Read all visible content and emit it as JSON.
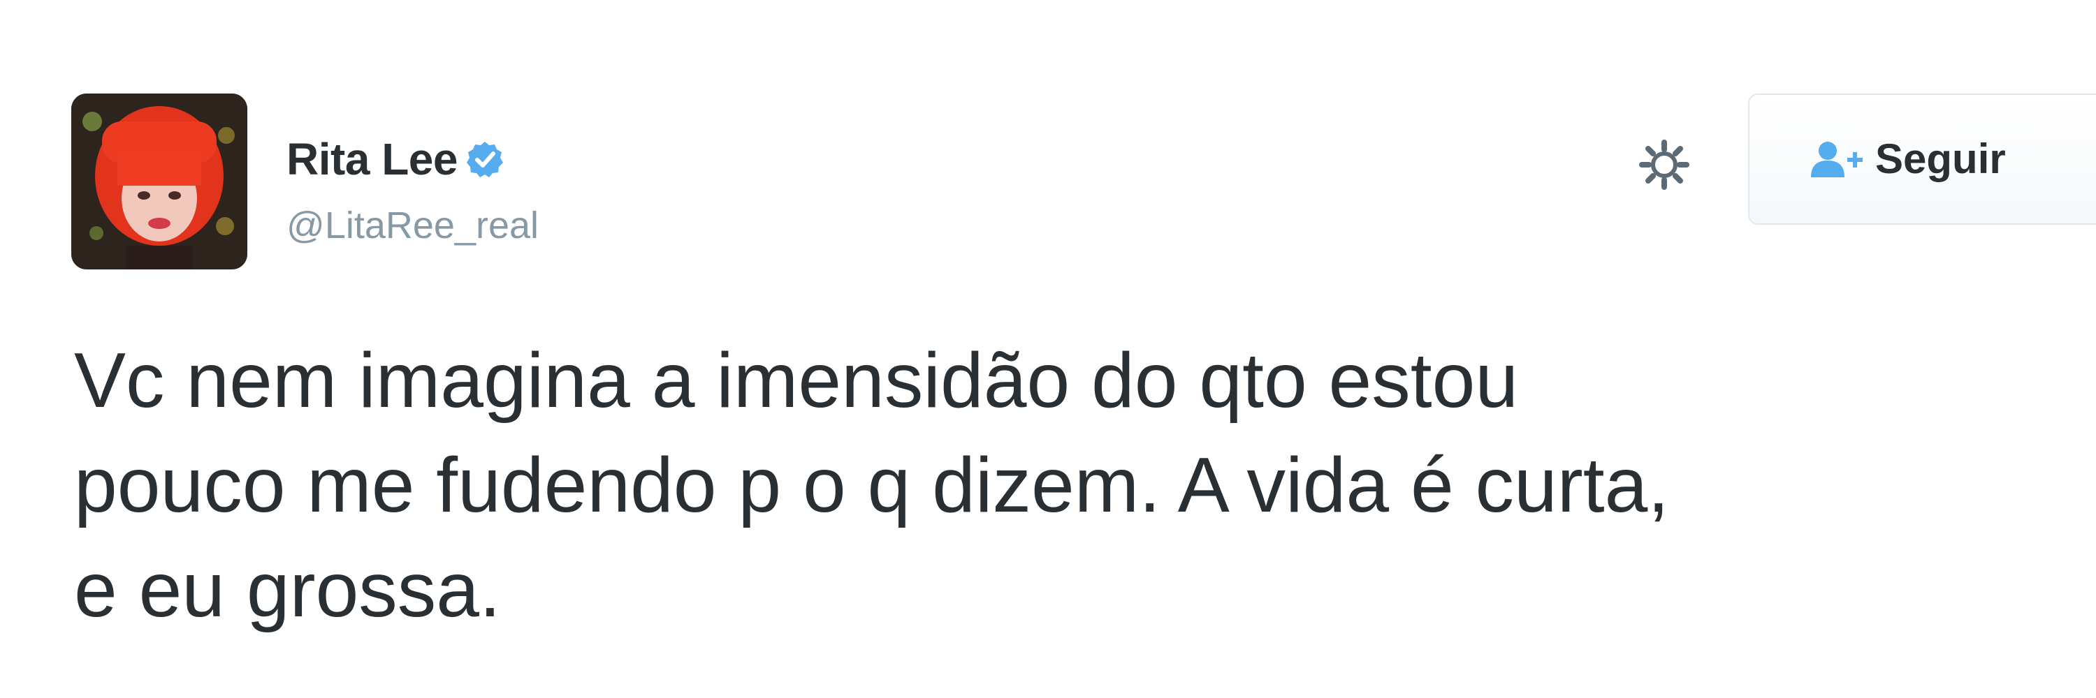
{
  "tweet": {
    "author": {
      "display_name": "Rita Lee",
      "handle": "@LitaRee_real",
      "avatar_icon": "avatar-red-hair-portrait",
      "verified_icon": "verified-badge-icon"
    },
    "actions": {
      "gear_icon": "gear-icon",
      "follow_icon": "add-user-icon",
      "follow_label": "Seguir"
    },
    "text_lines": [
      "Vc nem imagina a imensidão do qto estou",
      "pouco me fudendo p o q dizem. A vida é curta,",
      "e eu grossa."
    ]
  },
  "colors": {
    "text": "#292f33",
    "handle": "#8899a6",
    "verified": "#55acee",
    "follow_icon": "#55acee",
    "border": "#e1e8ed"
  }
}
